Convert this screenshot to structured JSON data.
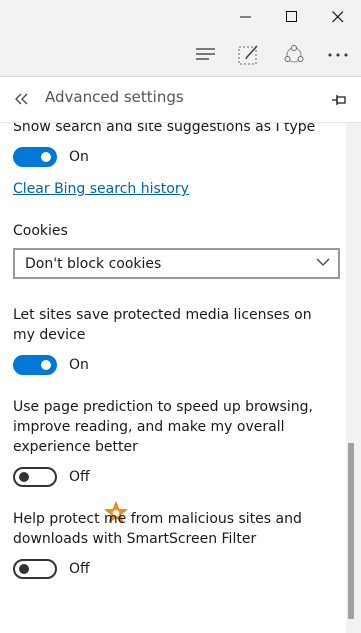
{
  "window": {
    "minimize_icon": "minimize-icon",
    "maximize_icon": "maximize-icon",
    "close_icon": "close-icon"
  },
  "toolbar": {
    "icons": [
      "hub-icon",
      "web-note-icon",
      "share-icon",
      "more-icon"
    ]
  },
  "panel": {
    "title": "Advanced settings",
    "back_icon": "double-chevron-left-icon",
    "pin_icon": "pin-icon"
  },
  "settings": {
    "search_suggestions": {
      "label": "Show search and site suggestions as I type",
      "state": "On"
    },
    "clear_bing_link": "Clear Bing search history",
    "cookies": {
      "label": "Cookies",
      "selected": "Don't block cookies"
    },
    "media_licenses": {
      "label": "Let sites save protected media licenses on my device",
      "state": "On"
    },
    "page_prediction": {
      "label": "Use page prediction to speed up browsing, improve reading, and make my overall experience better",
      "state": "Off"
    },
    "smartscreen": {
      "label": "Help protect me from malicious sites and downloads with SmartScreen Filter",
      "state": "Off"
    }
  },
  "colors": {
    "accent": "#0078d7",
    "link": "#0063b1",
    "annotation_star": "#f7931e"
  }
}
